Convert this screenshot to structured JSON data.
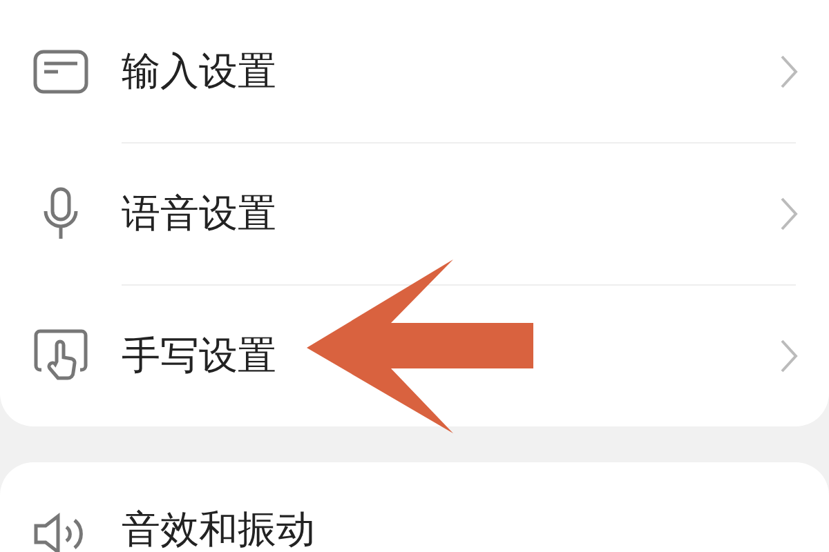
{
  "groups": [
    {
      "items": [
        {
          "label": "输入设置",
          "chevron": true
        },
        {
          "label": "语音设置",
          "chevron": true
        },
        {
          "label": "手写设置",
          "chevron": true
        }
      ]
    },
    {
      "items": [
        {
          "label": "音效和振动",
          "chevron": false
        }
      ]
    }
  ]
}
